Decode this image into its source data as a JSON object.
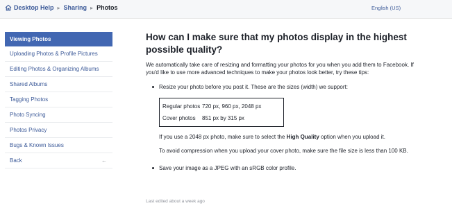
{
  "header": {
    "breadcrumb": [
      "Desktop Help",
      "Sharing",
      "Photos"
    ],
    "language": "English (US)"
  },
  "sidebar": {
    "items": [
      {
        "label": "Viewing Photos",
        "active": true
      },
      {
        "label": "Uploading Photos & Profile Pictures"
      },
      {
        "label": "Editing Photos & Organizing Albums"
      },
      {
        "label": "Shared Albums"
      },
      {
        "label": "Tagging Photos"
      },
      {
        "label": "Photo Syncing"
      },
      {
        "label": "Photos Privacy"
      },
      {
        "label": "Bugs & Known Issues"
      },
      {
        "label": "Back"
      }
    ]
  },
  "article": {
    "title": "How can I make sure that my photos display in the highest possible quality?",
    "intro": "We automatically take care of resizing and formatting your photos for you when you add them to Facebook. If you'd like to use more advanced techniques to make your photos look better, try these tips:",
    "bullet1": "Resize your photo before you post it. These are the sizes (width) we support:",
    "sizes": [
      {
        "label": "Regular photos",
        "value": "720 px, 960 px, 2048 px"
      },
      {
        "label": "Cover photos",
        "value": "851 px by 315 px"
      }
    ],
    "note1_prefix": "If you use a 2048 px photo, make sure to select the ",
    "note1_bold": "High Quality",
    "note1_suffix": " option when you upload it.",
    "note2": "To avoid compression when you upload your cover photo, make sure the file size is less than 100 KB.",
    "bullet2": "Save your image as a JPEG with an sRGB color profile.",
    "edited": "Last edited about a week ago"
  },
  "colors": {
    "accent": "#4267b2",
    "link": "#3b5998"
  }
}
